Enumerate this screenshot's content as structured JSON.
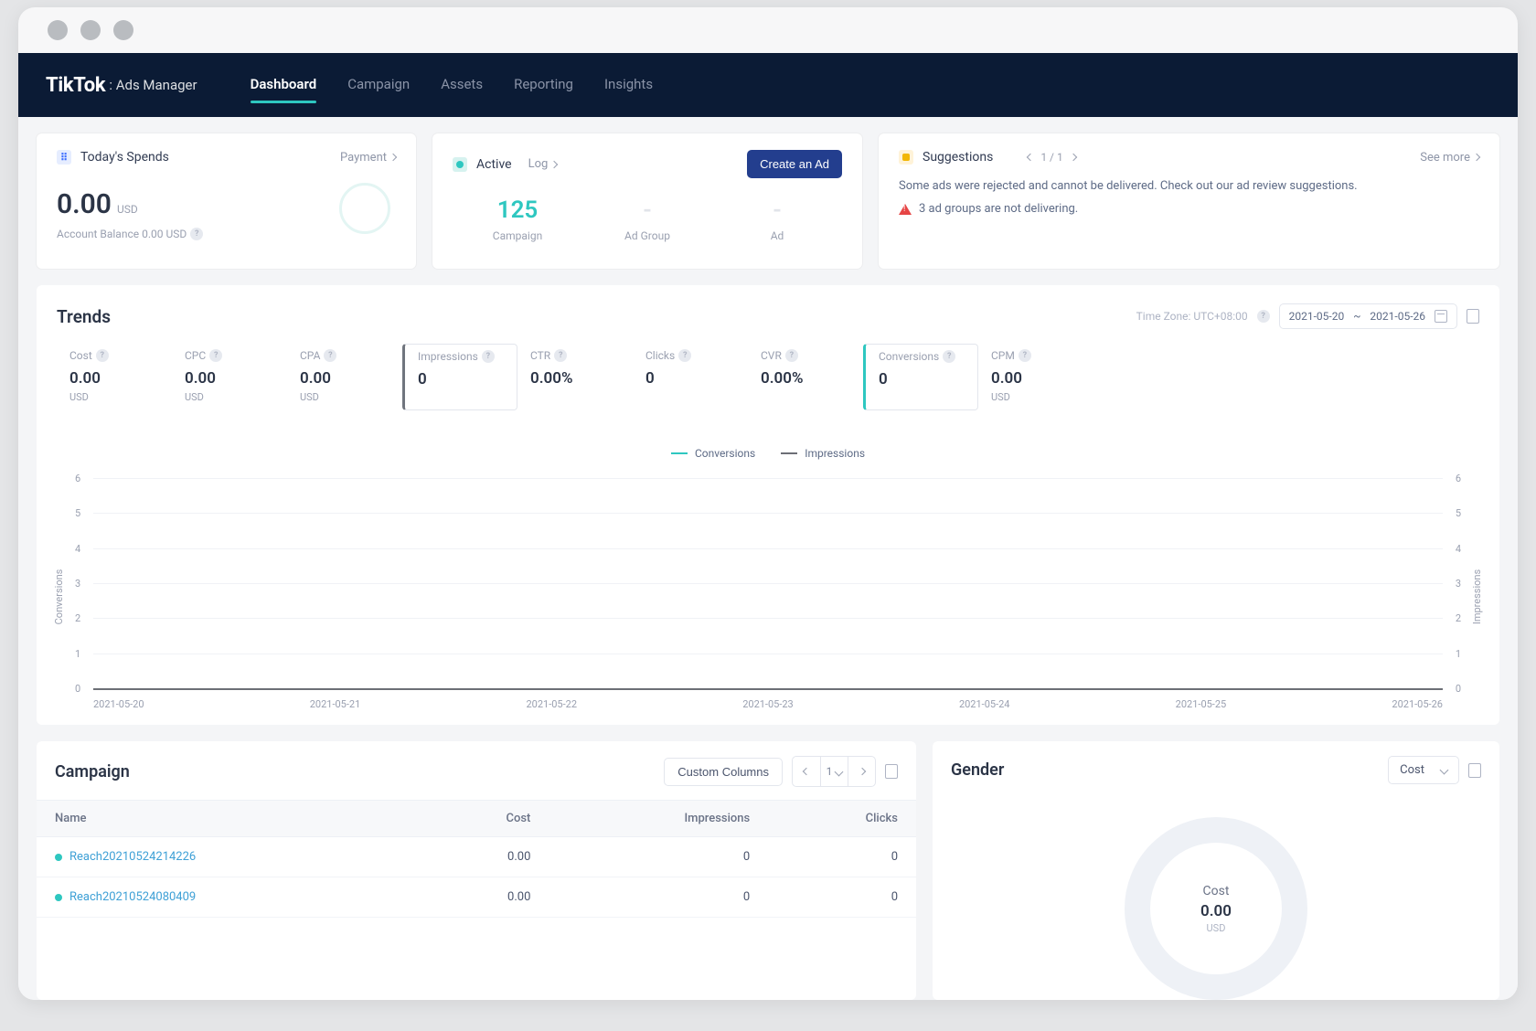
{
  "brand": {
    "name": "TikTok",
    "suffix": ": Ads Manager"
  },
  "nav": {
    "items": [
      "Dashboard",
      "Campaign",
      "Assets",
      "Reporting",
      "Insights"
    ],
    "activeIndex": 0
  },
  "spends": {
    "title": "Today's Spends",
    "paymentLabel": "Payment",
    "amount": "0.00",
    "currency": "USD",
    "balanceLabel": "Account Balance 0.00 USD"
  },
  "activeCard": {
    "status": "Active",
    "logLabel": "Log",
    "createBtn": "Create an Ad",
    "cols": [
      {
        "value": "125",
        "label": "Campaign"
      },
      {
        "value": "-",
        "label": "Ad Group"
      },
      {
        "value": "-",
        "label": "Ad"
      }
    ]
  },
  "suggestions": {
    "title": "Suggestions",
    "page": "1 / 1",
    "seeMore": "See more",
    "message": "Some ads were rejected and cannot be delivered. Check out our ad review suggestions.",
    "warning": "3 ad groups are not delivering."
  },
  "trends": {
    "title": "Trends",
    "tzLabel": "Time Zone: UTC+08:00",
    "dateFrom": "2021-05-20",
    "dateTo": "2021-05-26",
    "metrics": [
      {
        "label": "Cost",
        "value": "0.00",
        "unit": "USD",
        "selected": false
      },
      {
        "label": "CPC",
        "value": "0.00",
        "unit": "USD",
        "selected": false
      },
      {
        "label": "CPA",
        "value": "0.00",
        "unit": "USD",
        "selected": false
      },
      {
        "label": "Impressions",
        "value": "0",
        "unit": "",
        "selected": "gray"
      },
      {
        "label": "CTR",
        "value": "0.00%",
        "unit": "",
        "selected": false
      },
      {
        "label": "Clicks",
        "value": "0",
        "unit": "",
        "selected": false
      },
      {
        "label": "CVR",
        "value": "0.00%",
        "unit": "",
        "selected": false
      },
      {
        "label": "Conversions",
        "value": "0",
        "unit": "",
        "selected": "teal"
      },
      {
        "label": "CPM",
        "value": "0.00",
        "unit": "USD",
        "selected": false
      }
    ],
    "legend": [
      "Conversions",
      "Impressions"
    ],
    "yLeftLabel": "Conversions",
    "yRightLabel": "Impressions"
  },
  "chart_data": {
    "type": "line",
    "x": [
      "2021-05-20",
      "2021-05-21",
      "2021-05-22",
      "2021-05-23",
      "2021-05-24",
      "2021-05-25",
      "2021-05-26"
    ],
    "series": [
      {
        "name": "Conversions",
        "values": [
          0,
          0,
          0,
          0,
          0,
          0,
          0
        ],
        "axis": "left"
      },
      {
        "name": "Impressions",
        "values": [
          0,
          0,
          0,
          0,
          0,
          0,
          0
        ],
        "axis": "right"
      }
    ],
    "yLeft": {
      "label": "Conversions",
      "range": [
        0,
        6
      ],
      "ticks": [
        0,
        1,
        2,
        3,
        4,
        5,
        6
      ]
    },
    "yRight": {
      "label": "Impressions",
      "range": [
        0,
        6
      ],
      "ticks": [
        0,
        1,
        2,
        3,
        4,
        5,
        6
      ]
    },
    "title": "",
    "xlabel": "",
    "grid": true,
    "legendPosition": "top"
  },
  "campaignTable": {
    "title": "Campaign",
    "customColumnsBtn": "Custom Columns",
    "page": "1",
    "headers": [
      "Name",
      "Cost",
      "Impressions",
      "Clicks"
    ],
    "rows": [
      {
        "name": "Reach20210524214226",
        "cost": "0.00",
        "impressions": "0",
        "clicks": "0"
      },
      {
        "name": "Reach20210524080409",
        "cost": "0.00",
        "impressions": "0",
        "clicks": "0"
      }
    ]
  },
  "gender": {
    "title": "Gender",
    "selectValue": "Cost",
    "centerLabel": "Cost",
    "centerValue": "0.00",
    "centerUnit": "USD"
  }
}
